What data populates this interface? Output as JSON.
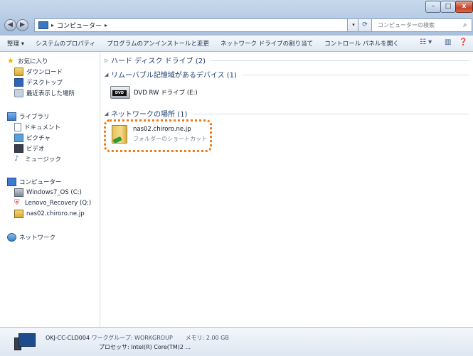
{
  "window": {
    "controls": {
      "minimize": "–",
      "maximize": "□",
      "close": "x"
    }
  },
  "address_bar": {
    "back": "◀",
    "forward": "▶",
    "sep1": "▸",
    "crumb": "コンピューター",
    "sep2": "▸",
    "dropdown": "▾",
    "refresh": "⟳"
  },
  "search": {
    "placeholder": "コンピューターの検索",
    "icon": "search-icon"
  },
  "command_bar": {
    "items": [
      "整理 ▾",
      "システムのプロパティ",
      "プログラムのアンインストールと変更",
      "ネットワーク ドライブの割り当て",
      "コントロール パネルを開く"
    ],
    "view": "☷ ▾",
    "pane": "▥",
    "help": "❓"
  },
  "sidebar": {
    "favorites": {
      "label": "お気に入り",
      "items": [
        "ダウンロード",
        "デスクトップ",
        "最近表示した場所"
      ]
    },
    "libraries": {
      "label": "ライブラリ",
      "items": [
        "ドキュメント",
        "ピクチャ",
        "ビデオ",
        "ミュージック"
      ]
    },
    "computer": {
      "label": "コンピューター",
      "items": [
        "Windows7_OS (C:)",
        "Lenovo_Recovery (Q:)",
        "nas02.chiroro.ne.jp"
      ]
    },
    "network": {
      "label": "ネットワーク"
    }
  },
  "content": {
    "groups": [
      {
        "label": "ハード ディスク ドライブ (2)"
      },
      {
        "label": "リムーバブル記憶域があるデバイス (1)"
      },
      {
        "label": "ネットワークの場所 (1)"
      }
    ],
    "dvd": {
      "icon_label": "DVD",
      "name": "DVD RW ドライブ (E:)"
    },
    "shortcut": {
      "name": "nas02.chiroro.ne.jp",
      "type": "フォルダーのショートカット"
    }
  },
  "details": {
    "computer_name": "OKJ-CC-CLD004",
    "workgroup": "ワークグループ: WORKGROUP",
    "memory": "メモリ: 2.00 GB",
    "processor": "プロセッサ: Intel(R) Core(TM)2 ..."
  }
}
